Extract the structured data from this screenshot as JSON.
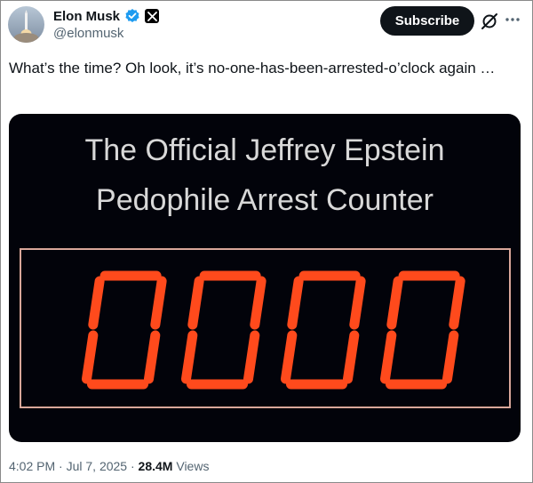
{
  "author": {
    "name": "Elon Musk",
    "handle": "@elonmusk"
  },
  "header": {
    "subscribe_label": "Subscribe"
  },
  "tweet": {
    "text": "What’s the time? Oh look, it’s no-one-has-been-arrested-o’clock again …"
  },
  "media": {
    "title_line1": "The Official Jeffrey Epstein",
    "title_line2": "Pedophile Arrest Counter",
    "counter_value": "0000",
    "digit_color": "#ff4a1c"
  },
  "footer": {
    "time": "4:02 PM",
    "date": "Jul 7, 2025",
    "views_count": "28.4M",
    "views_label": "Views"
  },
  "icons": {
    "verified": "verified-badge-icon",
    "x_logo": "x-logo-icon",
    "grok": "grok-icon",
    "more": "more-icon"
  }
}
